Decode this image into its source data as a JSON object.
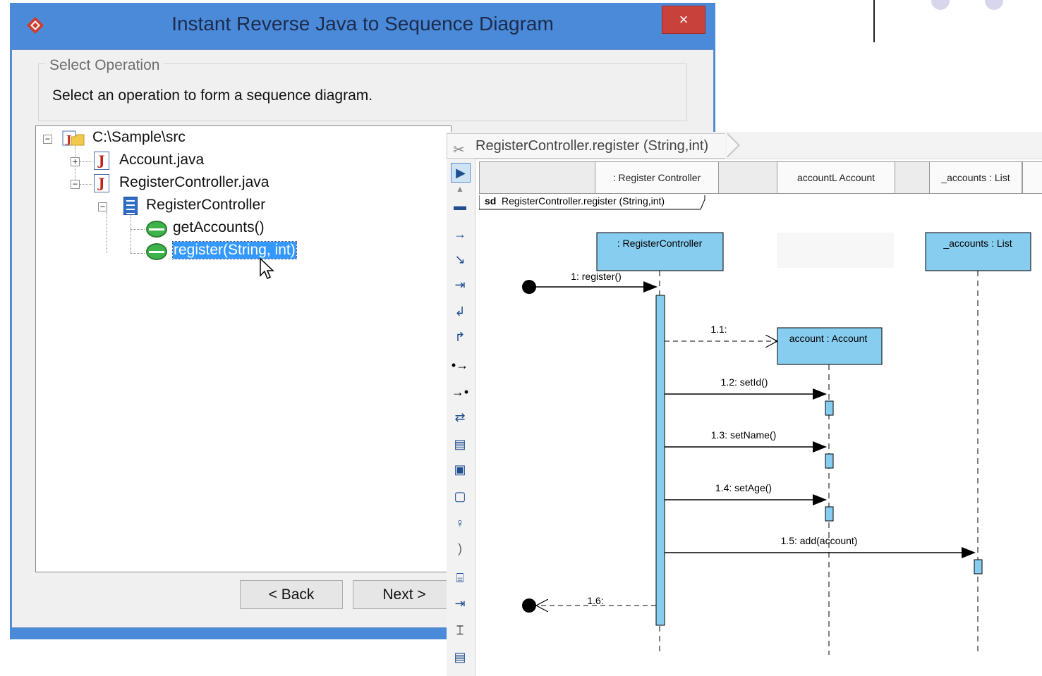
{
  "dialog": {
    "title": "Instant Reverse Java to Sequence Diagram",
    "close_label": "×",
    "group_label": "Select Operation",
    "description": "Select an operation to form a sequence diagram.",
    "tree": {
      "root": "C:\\Sample\\src",
      "file1": "Account.java",
      "file2": "RegisterController.java",
      "class": "RegisterController",
      "op1": "getAccounts()",
      "op2": "register(String, int)"
    },
    "back_label": "< Back",
    "next_label": "Next >"
  },
  "editor": {
    "breadcrumb": "RegisterController.register (String,int)",
    "lanes": [
      ": Register Controller",
      "accountL Account",
      "_accounts : List"
    ],
    "frame_keyword": "sd",
    "frame_name": "RegisterController.register (String,int)",
    "lifelines": {
      "controller": ": RegisterController",
      "account": "account : Account",
      "list": "_accounts : List"
    },
    "messages": {
      "m1": "1: register()",
      "m11": "1.1:",
      "m12": "1.2: setId()",
      "m13": "1.3: setName()",
      "m14": "1.4: setAge()",
      "m15": "1.5: add(account)",
      "m16": "1.6:"
    },
    "colors": {
      "lifeline_fill": "#87cdf0",
      "selection": "#3399ff",
      "dialog_frame": "#4a8ad8",
      "close": "#c8413a"
    }
  }
}
